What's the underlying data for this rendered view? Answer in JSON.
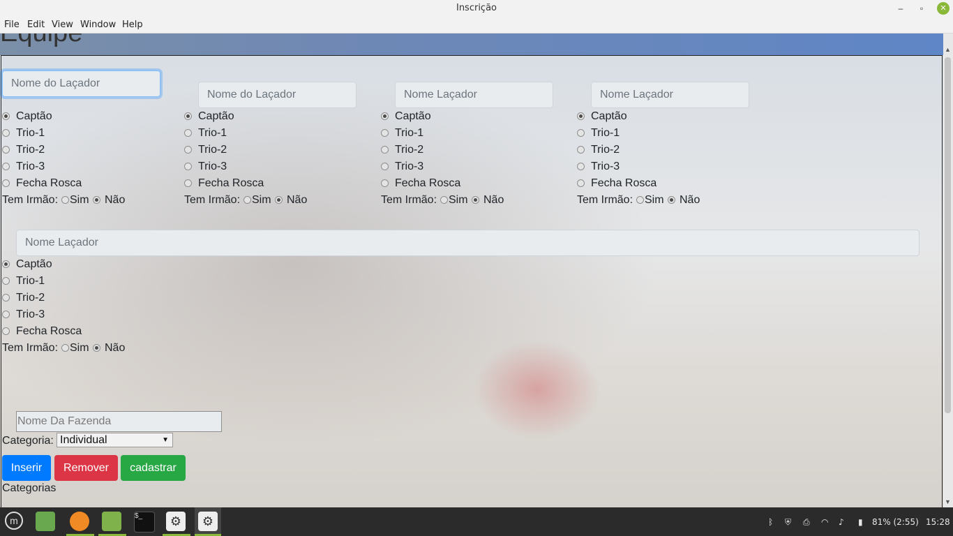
{
  "window": {
    "title": "Inscrição",
    "minimize": "–",
    "maximize": "▫",
    "close": "✕"
  },
  "menu": [
    "File",
    "Edit",
    "View",
    "Window",
    "Help"
  ],
  "page": {
    "header": "Equipe"
  },
  "lacadores": [
    {
      "placeholder": "Nome do Laçador",
      "focused": true,
      "options": [
        "Captão",
        "Trio-1",
        "Trio-2",
        "Trio-3",
        "Fecha Rosca"
      ],
      "selected": "Captão",
      "irmao_label": "Tem Irmão:",
      "irmao_options": [
        "Sim",
        "Não"
      ],
      "irmao_selected": "Não"
    },
    {
      "placeholder": "Nome do Laçador",
      "focused": false,
      "options": [
        "Captão",
        "Trio-1",
        "Trio-2",
        "Trio-3",
        "Fecha Rosca"
      ],
      "selected": "Captão",
      "irmao_label": "Tem Irmão:",
      "irmao_options": [
        "Sim",
        "Não"
      ],
      "irmao_selected": "Não"
    },
    {
      "placeholder": "Nome Laçador",
      "focused": false,
      "options": [
        "Captão",
        "Trio-1",
        "Trio-2",
        "Trio-3",
        "Fecha Rosca"
      ],
      "selected": "Captão",
      "irmao_label": "Tem Irmão:",
      "irmao_options": [
        "Sim",
        "Não"
      ],
      "irmao_selected": "Não"
    },
    {
      "placeholder": "Nome Laçador",
      "focused": false,
      "options": [
        "Captão",
        "Trio-1",
        "Trio-2",
        "Trio-3",
        "Fecha Rosca"
      ],
      "selected": "Captão",
      "irmao_label": "Tem Irmão:",
      "irmao_options": [
        "Sim",
        "Não"
      ],
      "irmao_selected": "Não"
    },
    {
      "placeholder": "Nome Laçador",
      "focused": false,
      "options": [
        "Captão",
        "Trio-1",
        "Trio-2",
        "Trio-3",
        "Fecha Rosca"
      ],
      "selected": "Captão",
      "irmao_label": "Tem Irmão:",
      "irmao_options": [
        "Sim",
        "Não"
      ],
      "irmao_selected": "Não"
    }
  ],
  "fazenda": {
    "placeholder": "Nome Da Fazenda"
  },
  "categoria": {
    "label": "Categoria:",
    "selected": "Individual"
  },
  "buttons": {
    "inserir": "Inserir",
    "remover": "Remover",
    "cadastrar": "cadastrar"
  },
  "categorias_title": "Categorias",
  "taskbar": {
    "apps": [
      "mint-menu-icon",
      "files-icon",
      "firefox-icon",
      "folder-icon",
      "terminal-icon",
      "settings-icon",
      "settings-active-icon"
    ],
    "battery": "81% (2:55)",
    "clock": "15:28"
  },
  "colors": {
    "primary": "#007bff",
    "danger": "#dc3545",
    "success": "#28a745",
    "mint": "#8ab83a"
  }
}
